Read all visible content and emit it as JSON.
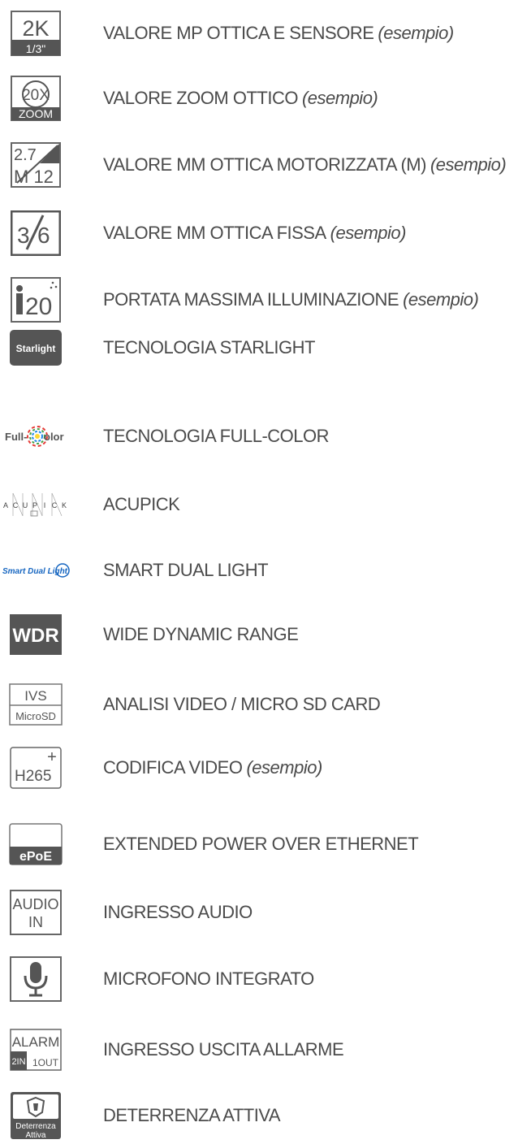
{
  "items": [
    {
      "icon": "resolution-sensor-icon",
      "icon_text": [
        "2K",
        "1/3\""
      ],
      "label": "VALORE MP OTTICA E SENSORE",
      "note": "(esempio)"
    },
    {
      "icon": "optical-zoom-icon",
      "icon_text": [
        "20X",
        "ZOOM"
      ],
      "label": "VALORE ZOOM OTTICO",
      "note": "(esempio)"
    },
    {
      "icon": "motorized-lens-icon",
      "icon_text": [
        "2.7",
        "M 12"
      ],
      "label": "VALORE MM OTTICA MOTORIZZATA (M)",
      "note": "(esempio)"
    },
    {
      "icon": "fixed-lens-icon",
      "icon_text": [
        "3",
        "6"
      ],
      "label": "VALORE MM OTTICA FISSA",
      "note": "(esempio)"
    },
    {
      "icon": "ir-range-icon",
      "icon_text": [
        "20"
      ],
      "label": "PORTATA MASSIMA ILLUMINAZIONE",
      "note": "(esempio)"
    },
    {
      "icon": "starlight-icon",
      "icon_text": [
        "Starlight"
      ],
      "label": "TECNOLOGIA STARLIGHT",
      "note": ""
    },
    {
      "icon": "full-color-icon",
      "icon_text": [
        "Full-",
        "olor"
      ],
      "label": "TECNOLOGIA FULL-COLOR",
      "note": ""
    },
    {
      "icon": "acupick-icon",
      "icon_text": [
        "A",
        "C",
        "U",
        "P",
        "I",
        "C",
        "K"
      ],
      "label": "ACUPICK",
      "note": ""
    },
    {
      "icon": "smart-dual-light-icon",
      "icon_text": [
        "Smart Dual Light"
      ],
      "label": "SMART DUAL LIGHT",
      "note": ""
    },
    {
      "icon": "wdr-icon",
      "icon_text": [
        "WDR"
      ],
      "label": "WIDE DYNAMIC RANGE",
      "note": ""
    },
    {
      "icon": "ivs-microsd-icon",
      "icon_text": [
        "IVS",
        "MicroSD"
      ],
      "label": "ANALISI VIDEO / MICRO SD CARD",
      "note": ""
    },
    {
      "icon": "codec-icon",
      "icon_text": [
        "H265",
        "+"
      ],
      "label": "CODIFICA VIDEO",
      "note": "(esempio)"
    },
    {
      "icon": "epoe-icon",
      "icon_text": [
        "ePoE"
      ],
      "label": "EXTENDED POWER OVER ETHERNET",
      "note": ""
    },
    {
      "icon": "audio-in-icon",
      "icon_text": [
        "AUDIO",
        "IN"
      ],
      "label": "INGRESSO AUDIO",
      "note": ""
    },
    {
      "icon": "microphone-icon",
      "icon_text": [],
      "label": "MICROFONO INTEGRATO",
      "note": ""
    },
    {
      "icon": "alarm-io-icon",
      "icon_text": [
        "ALARM",
        "2IN",
        "1OUT"
      ],
      "label": "INGRESSO USCITA ALLARME",
      "note": ""
    },
    {
      "icon": "active-deterrence-icon",
      "icon_text": [
        "Deterrenza",
        "Attiva"
      ],
      "label": "DETERRENZA ATTIVA",
      "note": ""
    }
  ],
  "colors": {
    "text": "#4b4b4b",
    "icon_dark": "#555555",
    "icon_border": "#666666"
  }
}
